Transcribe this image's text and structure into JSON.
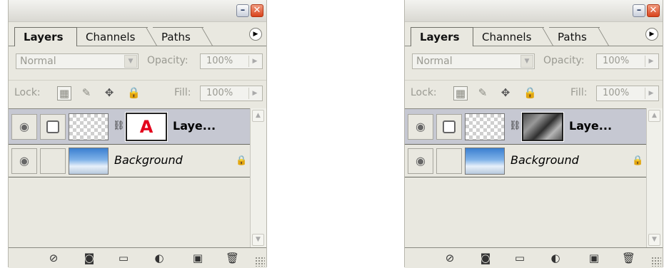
{
  "panels": [
    {
      "tabs": [
        "Layers",
        "Channels",
        "Paths"
      ],
      "blend_mode": "Normal",
      "opacity_label": "Opacity:",
      "opacity_value": "100%",
      "lock_label": "Lock:",
      "fill_label": "Fill:",
      "fill_value": "100%",
      "layers": [
        {
          "name": "Laye...",
          "selected": true,
          "mask_content": "A"
        },
        {
          "name": "Background",
          "selected": false
        }
      ]
    },
    {
      "tabs": [
        "Layers",
        "Channels",
        "Paths"
      ],
      "blend_mode": "Normal",
      "opacity_label": "Opacity:",
      "opacity_value": "100%",
      "lock_label": "Lock:",
      "fill_label": "Fill:",
      "fill_value": "100%",
      "layers": [
        {
          "name": "Laye...",
          "selected": true,
          "mask_content": "photo"
        },
        {
          "name": "Background",
          "selected": false
        }
      ]
    }
  ],
  "icons": {
    "minimize": "minimize-icon",
    "close": "close-icon",
    "menu": "panel-menu-icon",
    "lock_transparent": "lock-transparent-icon",
    "lock_image": "lock-image-brush-icon",
    "lock_position": "lock-position-move-icon",
    "lock_all": "lock-all-icon",
    "eye": "eye-icon",
    "link": "chain-link-icon",
    "padlock": "padlock-icon",
    "bottom": [
      "link-layers-icon",
      "add-layer-mask-icon",
      "new-group-folder-icon",
      "adjustment-layer-icon",
      "new-layer-icon",
      "trash-icon"
    ]
  },
  "colors": {
    "panel_bg": "#e9e8e0",
    "selected_row": "#c6c8d2",
    "close_button": "#d9441d",
    "mask_text": "#e3001b"
  }
}
